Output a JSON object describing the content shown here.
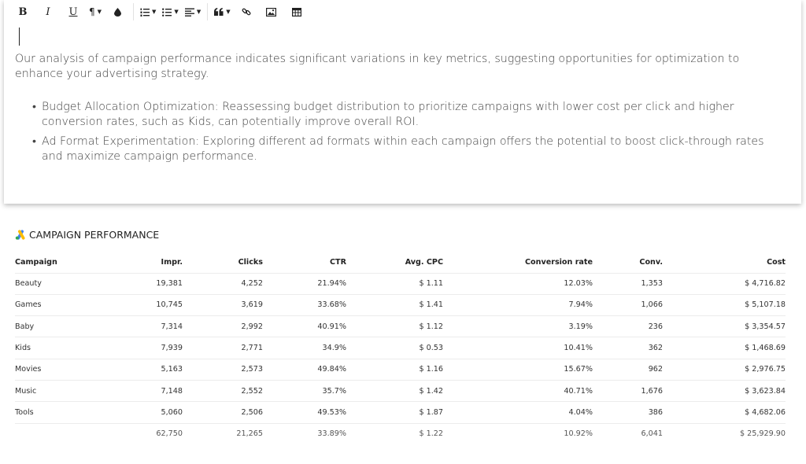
{
  "toolbar": {
    "bold": "B",
    "italic": "I",
    "underline": "U",
    "paragraph_icon": "¶",
    "color_icon": "💧",
    "ordered_list_icon": "☷",
    "bullet_list_icon": "☰",
    "align_icon": "≡",
    "quote_icon": "❝",
    "link_icon": "🔗",
    "image_icon": "🖼",
    "table_icon": "▦"
  },
  "document": {
    "intro": "Our analysis of campaign performance indicates significant variations in key metrics, suggesting opportunities for optimization to enhance your advertising strategy.",
    "bullets": [
      "Budget Allocation Optimization: Reassessing budget distribution to prioritize campaigns with lower cost per click and higher conversion rates, such as Kids, can potentially improve overall ROI.",
      "Ad Format Experimentation: Exploring different ad formats within each campaign offers the potential to boost click-through rates and maximize campaign performance."
    ]
  },
  "section": {
    "title": "CAMPAIGN PERFORMANCE"
  },
  "table": {
    "headers": [
      "Campaign",
      "Impr.",
      "Clicks",
      "CTR",
      "Avg. CPC",
      "Conversion rate",
      "Conv.",
      "Cost"
    ],
    "rows": [
      [
        "Beauty",
        "19,381",
        "4,252",
        "21.94%",
        "$ 1.11",
        "12.03%",
        "1,353",
        "$ 4,716.82"
      ],
      [
        "Games",
        "10,745",
        "3,619",
        "33.68%",
        "$ 1.41",
        "7.94%",
        "1,066",
        "$ 5,107.18"
      ],
      [
        "Baby",
        "7,314",
        "2,992",
        "40.91%",
        "$ 1.12",
        "3.19%",
        "236",
        "$ 3,354.57"
      ],
      [
        "Kids",
        "7,939",
        "2,771",
        "34.9%",
        "$ 0.53",
        "10.41%",
        "362",
        "$ 1,468.69"
      ],
      [
        "Movies",
        "5,163",
        "2,573",
        "49.84%",
        "$ 1.16",
        "15.67%",
        "962",
        "$ 2,976.75"
      ],
      [
        "Music",
        "7,148",
        "2,552",
        "35.7%",
        "$ 1.42",
        "40.71%",
        "1,676",
        "$ 3,623.84"
      ],
      [
        "Tools",
        "5,060",
        "2,506",
        "49.53%",
        "$ 1.87",
        "4.04%",
        "386",
        "$ 4,682.06"
      ]
    ],
    "totals": [
      "",
      "62,750",
      "21,265",
      "33.89%",
      "$ 1.22",
      "10.92%",
      "6,041",
      "$ 25,929.90"
    ]
  },
  "colors": {
    "ads_blue": "#4285F4",
    "ads_yellow": "#FBBC04",
    "ads_green": "#34A853"
  }
}
